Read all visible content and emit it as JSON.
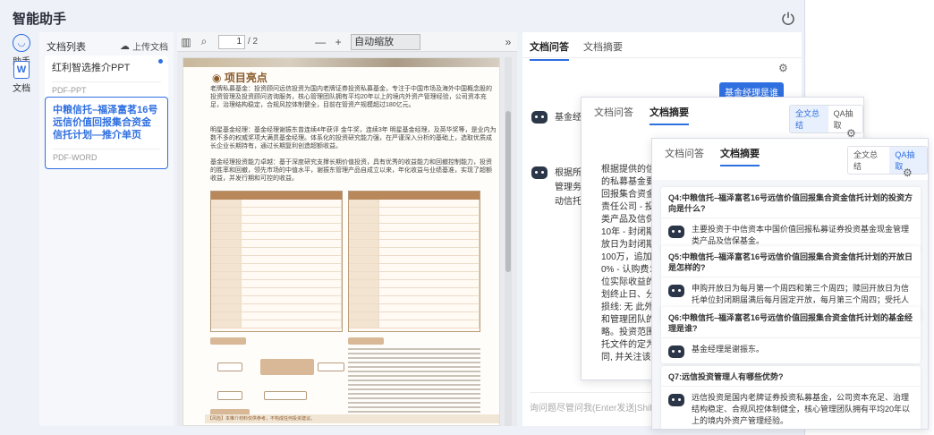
{
  "app": {
    "title": "智能助手"
  },
  "rail": {
    "assistant_label": "助手",
    "docs_label": "文档",
    "docs_icon_letter": "W"
  },
  "doclist": {
    "title": "文档列表",
    "upload_label": "上传文档",
    "items": [
      {
        "name": "红利智选推介PPT",
        "tag": "PDF-PPT",
        "active": false
      },
      {
        "name": "中粮信托–福泽富茗16号远信价值回报集合资金信托计划—推介单页",
        "tag": "PDF-WORD",
        "active": true
      }
    ]
  },
  "viewer": {
    "page_current": "1",
    "page_total": "/ 2",
    "zoom_value": "自动缩放",
    "page_heading": "项目亮点",
    "paragraphs": [
      "老牌私募基金：投资顾问远信投资为国内老牌证券投资私募基金，专注于中国市场及海外中国概念股的投资管理及投资顾问咨询服务，核心管理团队拥有平均20年以上的境内外资产管理经验，公司资本充足，治理结构稳定，合规风控体制健全，目前在管资产规模超过180亿元。",
      "明星基金经理：基金经理谢振东曾连续4年获评 金牛奖，连续3年 明星基金经理，及英华奖等，是业内为数不多的权威奖项大满贯基金经理。体系化的投资研究能力强，在严谨深入分析的基础上，选取优质成长企业长期持有，通过长期复利创造超额收益。",
      "基金经理投资能力卓越：基于深度研究支撑长期价值投资，具有优秀的收益能力和回撤控制能力，投资的胜率和回撤，领先市场的中值水平，谢振东管理产品自成立以来，年化收益与业绩基准，实现了超额收益，并发行期和可控的收益。"
    ],
    "footer_text": "【风险】本推介材料仅供参考，不构成任何投资建议。"
  },
  "chat": {
    "tabs": [
      "文档问答",
      "文档摘要"
    ],
    "user_message": "基金经理是谁",
    "bot_msg_1": "基金经",
    "bot_msg_2_lines": [
      "根据所",
      "管理务",
      "动信托"
    ],
    "input_placeholder": "询问题尽管问我(Enter发送|Shift + Enter换行)"
  },
  "window1": {
    "tabs": [
      "文档问答",
      "文档摘要"
    ],
    "seg": [
      "全文总结",
      "QA抽取"
    ],
    "summary_lines": [
      "根据提供的信息",
      "的私募基金要素",
      "回报集合资金信",
      "责任公司 - 投资",
      "类产品及信保基",
      "10年 - 封闭期：",
      "放日为封闭期结",
      "100万，追加认",
      "0% - 认购费：",
      "位实际收益的2",
      "划终止日、分红",
      "损线: 无 此外，",
      "和管理团队的背",
      "略。投资范围和",
      "托文件的定为准",
      "同, 并关注该信"
    ]
  },
  "window2": {
    "tabs": [
      "文档问答",
      "文档摘要"
    ],
    "seg": [
      "全文总结",
      "QA抽取"
    ],
    "qa": [
      {
        "q": "Q4:中粮信托–福泽富茗16号远信价值回报集合资金信托计划的投资方向是什么?",
        "a": "主要投资于中信资本中国价值回报私募证券投资基金现金管理类产品及信保基金。"
      },
      {
        "q": "Q5:中粮信托–福泽富茗16号远信价值回报集合资金信托计划的开放日是怎样的?",
        "a": "申购开放日为每月第一个周四和第三个周四；赎回开放日为信托单位封闭期届满后每月固定开放，每月第三个周四；受托人有权决定设置临时开放日。"
      },
      {
        "q": "Q6:中粮信托–福泽富茗16号远信价值回报集合资金信托计划的基金经理是谁?",
        "a": "基金经理是谢振东。"
      },
      {
        "q": "Q7:远信投资管理人有哪些优势?",
        "a": "远信投资是国内老牌证券投资私募基金，公司资本充足、治理结构稳定、合规风控体制健全，核心管理团队拥有平均20年以上的境内外资产管理经验。"
      }
    ]
  }
}
